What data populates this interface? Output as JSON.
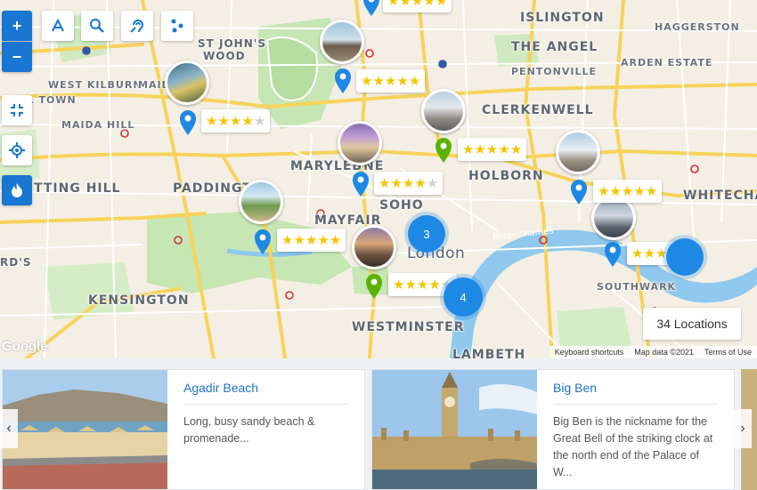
{
  "map": {
    "areas": {
      "islington": "ISLINGTON",
      "haggerston": "HAGGERSTON",
      "st_johns_wood_1": "ST JOHN'S",
      "st_johns_wood_2": "WOOD",
      "the_angel": "THE ANGEL",
      "pentonville": "PENTONVILLE",
      "arden_estate": "ARDEN ESTATE",
      "west_kilburn": "WEST KILBURN",
      "maida": "MAID",
      "kensal_town": "NSAL TOWN",
      "maida_hill": "MAIDA HILL",
      "clerkenwell": "CLERKENWELL",
      "marylebone": "MARYLEB",
      "marylebone_end": "NE",
      "notting_hill": "TTING HILL",
      "paddington": "PADDINGT",
      "holborn": "HOLBORN",
      "whitechapel": "WHITECHA",
      "soho": "SOHO",
      "mayfair": "MAYFAIR",
      "london": "London",
      "river_thames": "River Thames",
      "earls": "RD'S",
      "kensington": "KENSINGTON",
      "southwark": "SOUTHWARK",
      "westminster": "WESTMINSTER",
      "lambeth": "LAMBETH"
    },
    "ratings": [
      {
        "place": "top",
        "stars": 5
      },
      {
        "place": "st-johns-wood",
        "stars": 5
      },
      {
        "place": "maida-vale",
        "stars": 4
      },
      {
        "place": "british-museum",
        "stars": 5
      },
      {
        "place": "marylebone",
        "stars": 4
      },
      {
        "place": "st-pauls",
        "stars": 5
      },
      {
        "place": "hyde-park",
        "stars": 5
      },
      {
        "place": "tower-bridge",
        "stars": 5
      },
      {
        "place": "westminster",
        "stars": 4
      }
    ],
    "clusters": [
      "3",
      "4"
    ],
    "locations_count": "34 Locations",
    "google": "Google",
    "attribution": {
      "shortcuts": "Keyboard shortcuts",
      "data": "Map data ©2021",
      "terms": "Terms of Use"
    },
    "colors": {
      "pin_blue": "#1e88e5",
      "pin_green": "#59b300",
      "star": "#f5c500",
      "button_blue": "#1976d2",
      "thames": "#90c8ee"
    }
  },
  "controls": {
    "zoom_in": "+",
    "zoom_out": "−",
    "tool_icons": [
      "route-icon",
      "zoom-search-icon",
      "ear-icon",
      "waypoints-icon"
    ],
    "side_icons": [
      "fit-bounds-icon",
      "locate-icon",
      "heatmap-fire-icon"
    ]
  },
  "cards": [
    {
      "title": "Agadir Beach",
      "description": "Long, busy sandy beach & promenade..."
    },
    {
      "title": "Big Ben",
      "description": "Big Ben is the nickname for the Great Bell of the striking clock at the north end of the Palace of W..."
    }
  ],
  "carousel": {
    "prev": "‹",
    "next": "›"
  }
}
